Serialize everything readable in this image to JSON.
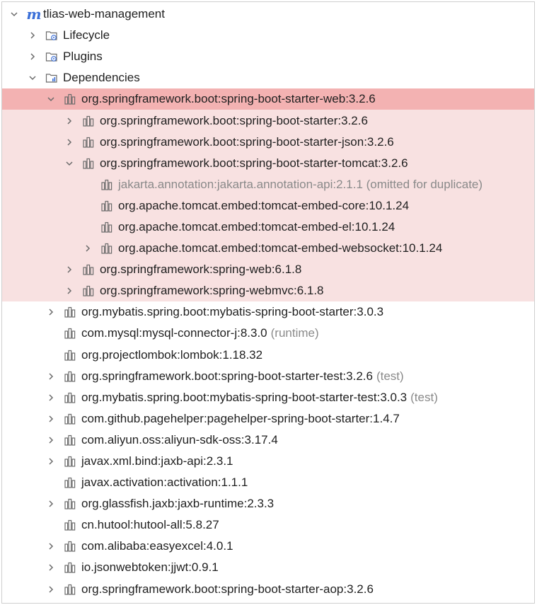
{
  "colors": {
    "selected_row": "#f3b2b2",
    "selected_block": "#f8e1e1",
    "muted_text": "#8a8a8a",
    "maven_logo": "#3a6fd8"
  },
  "root": {
    "label": "tlias-web-management",
    "icon": "maven-m-icon",
    "expanded": true
  },
  "nodes": [
    {
      "label": "Lifecycle",
      "level": 1,
      "arrow": "right",
      "icon": "folder-gear-icon"
    },
    {
      "label": "Plugins",
      "level": 1,
      "arrow": "right",
      "icon": "folder-gear-icon"
    },
    {
      "label": "Dependencies",
      "level": 1,
      "arrow": "down",
      "icon": "folder-chart-icon"
    },
    {
      "label": "org.springframework.boot:spring-boot-starter-web:3.2.6",
      "level": 2,
      "arrow": "down",
      "icon": "library-icon",
      "state": "selected"
    },
    {
      "label": "org.springframework.boot:spring-boot-starter:3.2.6",
      "level": 3,
      "arrow": "right",
      "icon": "library-icon",
      "state": "block"
    },
    {
      "label": "org.springframework.boot:spring-boot-starter-json:3.2.6",
      "level": 3,
      "arrow": "right",
      "icon": "library-icon",
      "state": "block"
    },
    {
      "label": "org.springframework.boot:spring-boot-starter-tomcat:3.2.6",
      "level": 3,
      "arrow": "down",
      "icon": "library-icon",
      "state": "block"
    },
    {
      "label": "jakarta.annotation:jakarta.annotation-api:2.1.1 (omitted for duplicate)",
      "level": 4,
      "arrow": "none",
      "icon": "library-icon",
      "state": "block",
      "muted": true
    },
    {
      "label": "org.apache.tomcat.embed:tomcat-embed-core:10.1.24",
      "level": 4,
      "arrow": "none",
      "icon": "library-icon",
      "state": "block"
    },
    {
      "label": "org.apache.tomcat.embed:tomcat-embed-el:10.1.24",
      "level": 4,
      "arrow": "none",
      "icon": "library-icon",
      "state": "block"
    },
    {
      "label": "org.apache.tomcat.embed:tomcat-embed-websocket:10.1.24",
      "level": 4,
      "arrow": "right",
      "icon": "library-icon",
      "state": "block"
    },
    {
      "label": "org.springframework:spring-web:6.1.8",
      "level": 3,
      "arrow": "right",
      "icon": "library-icon",
      "state": "block"
    },
    {
      "label": "org.springframework:spring-webmvc:6.1.8",
      "level": 3,
      "arrow": "right",
      "icon": "library-icon",
      "state": "block"
    },
    {
      "label": "org.mybatis.spring.boot:mybatis-spring-boot-starter:3.0.3",
      "level": 2,
      "arrow": "right",
      "icon": "library-icon"
    },
    {
      "label": "com.mysql:mysql-connector-j:8.3.0",
      "suffix": "(runtime)",
      "level": 2,
      "arrow": "none",
      "icon": "library-icon"
    },
    {
      "label": "org.projectlombok:lombok:1.18.32",
      "level": 2,
      "arrow": "none",
      "icon": "library-icon"
    },
    {
      "label": "org.springframework.boot:spring-boot-starter-test:3.2.6",
      "suffix": "(test)",
      "level": 2,
      "arrow": "right",
      "icon": "library-icon"
    },
    {
      "label": "org.mybatis.spring.boot:mybatis-spring-boot-starter-test:3.0.3",
      "suffix": "(test)",
      "level": 2,
      "arrow": "right",
      "icon": "library-icon"
    },
    {
      "label": "com.github.pagehelper:pagehelper-spring-boot-starter:1.4.7",
      "level": 2,
      "arrow": "right",
      "icon": "library-icon"
    },
    {
      "label": "com.aliyun.oss:aliyun-sdk-oss:3.17.4",
      "level": 2,
      "arrow": "right",
      "icon": "library-icon"
    },
    {
      "label": "javax.xml.bind:jaxb-api:2.3.1",
      "level": 2,
      "arrow": "right",
      "icon": "library-icon"
    },
    {
      "label": "javax.activation:activation:1.1.1",
      "level": 2,
      "arrow": "none",
      "icon": "library-icon"
    },
    {
      "label": "org.glassfish.jaxb:jaxb-runtime:2.3.3",
      "level": 2,
      "arrow": "right",
      "icon": "library-icon"
    },
    {
      "label": "cn.hutool:hutool-all:5.8.27",
      "level": 2,
      "arrow": "none",
      "icon": "library-icon"
    },
    {
      "label": "com.alibaba:easyexcel:4.0.1",
      "level": 2,
      "arrow": "right",
      "icon": "library-icon"
    },
    {
      "label": "io.jsonwebtoken:jjwt:0.9.1",
      "level": 2,
      "arrow": "right",
      "icon": "library-icon"
    },
    {
      "label": "org.springframework.boot:spring-boot-starter-aop:3.2.6",
      "level": 2,
      "arrow": "right",
      "icon": "library-icon"
    }
  ]
}
